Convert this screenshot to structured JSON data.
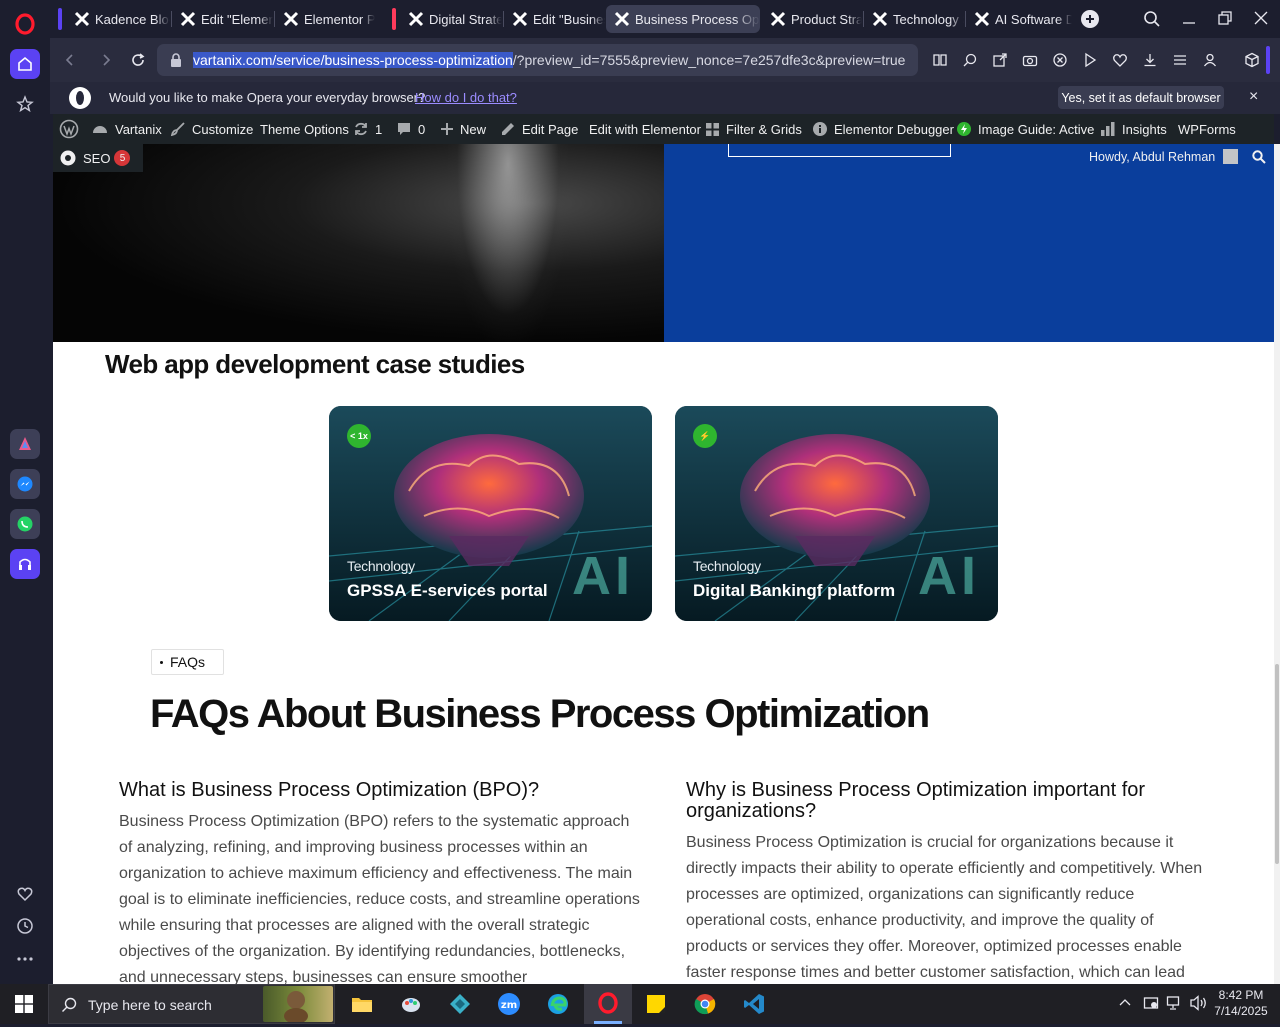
{
  "colors": {
    "opera_red": "#ff1b2d",
    "sidebar_bg": "#1c1e2e",
    "wp_bar_bg": "#1d2327",
    "hero_blue": "#0a3e9c",
    "badge_green": "#2fb52f",
    "seo_badge_red": "#d63638"
  },
  "tabs": [
    {
      "label": "Kadence Blocks",
      "active": false
    },
    {
      "label": "Edit \"Elementor",
      "active": false
    },
    {
      "label": "Elementor Page",
      "active": false
    },
    {
      "label": "Digital Strategy",
      "active": false
    },
    {
      "label": "Edit \"Business",
      "active": false
    },
    {
      "label": "Business Process Optimi",
      "active": true
    },
    {
      "label": "Product Strategy",
      "active": false
    },
    {
      "label": "Technology St",
      "active": false
    },
    {
      "label": "AI Software D",
      "active": false
    }
  ],
  "address": {
    "host_path": "vartanix.com/service/business-process-optimization",
    "query": "/?preview_id=7555&preview_nonce=7e257dfe3c&preview=true"
  },
  "default_bar": {
    "message": "Would you like to make Opera your everyday browser?",
    "link": "How do I do that?",
    "button": "Yes, set it as default browser",
    "close": "×"
  },
  "wp_bar": {
    "site": "Vartanix",
    "customize": "Customize",
    "theme_options": "Theme Options",
    "updates": "1",
    "comments": "0",
    "new": "New",
    "edit_page": "Edit Page",
    "edit_elementor": "Edit with Elementor",
    "filter_grids": "Filter & Grids",
    "elementor_debugger": "Elementor Debugger",
    "image_guide": "Image Guide: Active",
    "insights": "Insights",
    "wpforms": "WPForms",
    "seo": "SEO",
    "seo_count": "5",
    "howdy": "Howdy, Abdul Rehman"
  },
  "page": {
    "case_heading": "Web app development case studies",
    "cards": [
      {
        "badge": "< 1x",
        "tag": "Technology",
        "title": "GPSSA E-services portal",
        "art_text": "AI"
      },
      {
        "badge": "⚡",
        "tag": "Technology",
        "title": "Digital Bankingf platform",
        "art_text": "AI"
      }
    ],
    "faq_pill": "FAQs",
    "faq_heading": "FAQs About Business Process Optimization",
    "faqs": [
      {
        "q": "What is Business Process Optimization (BPO)?",
        "a": "Business Process Optimization (BPO) refers to the systematic approach of analyzing, refining, and improving business processes within an organization to achieve maximum efficiency and effectiveness. The main goal is to eliminate inefficiencies, reduce costs, and streamline operations while ensuring that processes are aligned with the overall strategic objectives of the organization. By identifying redundancies, bottlenecks, and unnecessary steps, businesses can ensure smoother"
      },
      {
        "q": "Why is Business Process Optimization important for organizations?",
        "a": "Business Process Optimization is crucial for organizations because it directly impacts their ability to operate efficiently and competitively. When processes are optimized, organizations can significantly reduce operational costs, enhance productivity, and improve the quality of products or services they offer. Moreover, optimized processes enable faster response times and better customer satisfaction, which can lead"
      }
    ]
  },
  "taskbar": {
    "search_placeholder": "Type here to search",
    "time": "8:42 PM",
    "date": "7/14/2025"
  },
  "icons": [
    "opera-logo-icon",
    "home-icon",
    "star-icon",
    "heart-icon",
    "clock-icon",
    "more-icon",
    "search-icon",
    "back-icon",
    "forward-icon",
    "reload-icon",
    "lock-icon",
    "wordpress-icon",
    "windows-start-icon"
  ]
}
